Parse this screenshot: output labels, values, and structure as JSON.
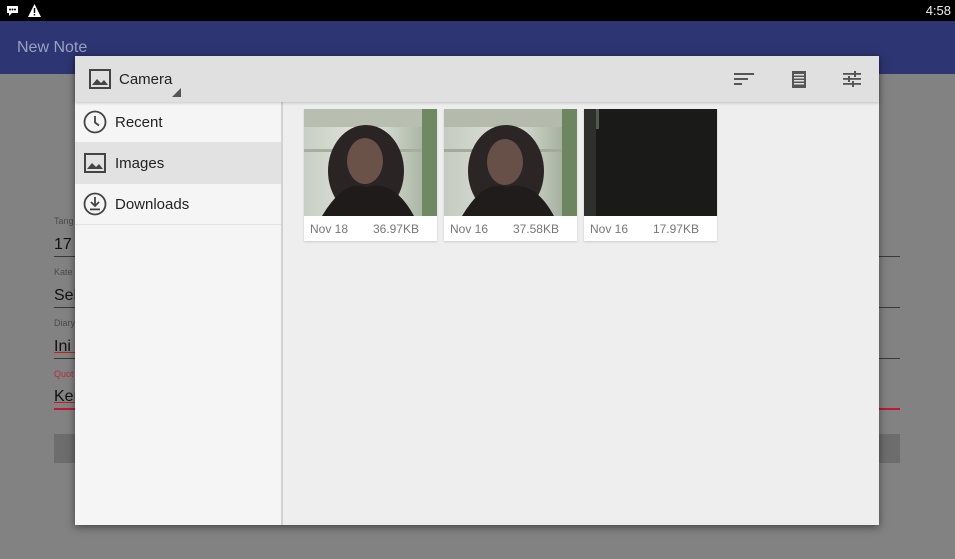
{
  "status_bar": {
    "time": "4:58",
    "icons": [
      "chat-bubble-icon",
      "warning-icon"
    ]
  },
  "background_app": {
    "title": "New Note",
    "fields": [
      {
        "label": "Tang",
        "value": "17"
      },
      {
        "label": "Kate",
        "value": "Sek"
      },
      {
        "label": "Diary",
        "value": "Ini a"
      },
      {
        "label": "Quot",
        "value": "Ker"
      }
    ]
  },
  "dialog": {
    "toolbar": {
      "root_label": "Camera",
      "root_icon": "image-icon",
      "actions": [
        "sort-icon",
        "list-view-icon",
        "settings-sliders-icon"
      ]
    },
    "drawer": {
      "items": [
        {
          "label": "Recent",
          "icon": "clock-icon",
          "active": false
        },
        {
          "label": "Images",
          "icon": "image-icon",
          "active": true
        },
        {
          "label": "Downloads",
          "icon": "download-icon",
          "active": false
        }
      ]
    },
    "files": [
      {
        "date": "Nov 18",
        "size": "36.97KB"
      },
      {
        "date": "Nov 16",
        "size": "37.58KB"
      },
      {
        "date": "Nov 16",
        "size": "17.97KB"
      }
    ]
  },
  "colors": {
    "app_bar": "#2d3572",
    "dialog_bg": "#eeeeee",
    "drawer_bg": "#f5f5f5",
    "active_item": "#e2e2e2",
    "accent_red": "#c01838"
  }
}
